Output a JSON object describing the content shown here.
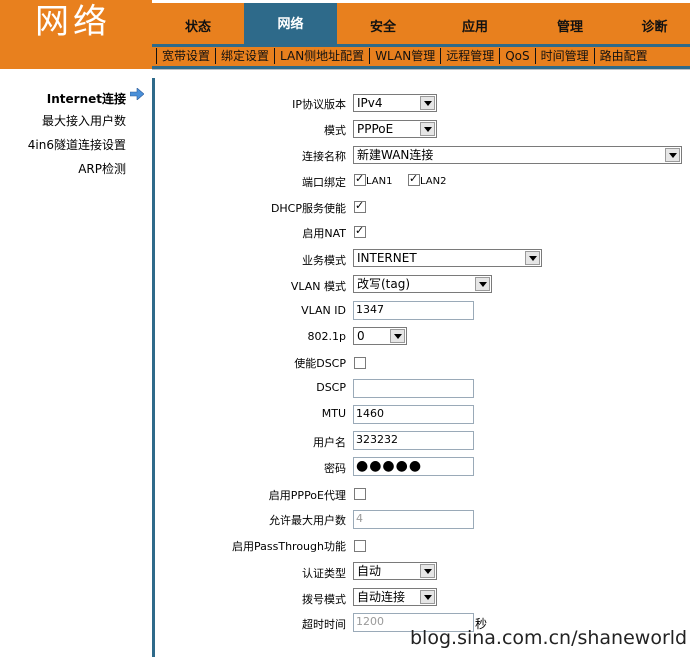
{
  "header": {
    "logo": "网络"
  },
  "topnav": [
    "状态",
    "网络",
    "安全",
    "应用",
    "管理",
    "诊断"
  ],
  "subnav": [
    "宽带设置",
    "绑定设置",
    "LAN侧地址配置",
    "WLAN管理",
    "远程管理",
    "QoS",
    "时间管理",
    "路由配置"
  ],
  "sidebar": [
    "Internet连接",
    "最大接入用户数",
    "4in6隧道连接设置",
    "ARP检测"
  ],
  "form": {
    "ip_version": {
      "label": "IP协议版本",
      "value": "IPv4"
    },
    "mode": {
      "label": "模式",
      "value": "PPPoE"
    },
    "conn_name": {
      "label": "连接名称",
      "value": "新建WAN连接"
    },
    "port_bind": {
      "label": "端口绑定",
      "lan1": "LAN1",
      "lan2": "LAN2"
    },
    "dhcp": {
      "label": "DHCP服务使能"
    },
    "nat": {
      "label": "启用NAT"
    },
    "service_mode": {
      "label": "业务模式",
      "value": "INTERNET"
    },
    "vlan_mode": {
      "label": "VLAN 模式",
      "value": "改写(tag)"
    },
    "vlan_id": {
      "label": "VLAN ID",
      "value": "1347"
    },
    "p8021": {
      "label": "802.1p",
      "value": "0"
    },
    "dscp_enable": {
      "label": "使能DSCP"
    },
    "dscp": {
      "label": "DSCP",
      "value": ""
    },
    "mtu": {
      "label": "MTU",
      "value": "1460"
    },
    "username": {
      "label": "用户名",
      "value": "323232"
    },
    "password": {
      "label": "密码",
      "value": "●●●●●"
    },
    "pppoe_proxy": {
      "label": "启用PPPoE代理"
    },
    "max_users": {
      "label": "允许最大用户数",
      "value": "4"
    },
    "passthrough": {
      "label": "启用PassThrough功能"
    },
    "auth_type": {
      "label": "认证类型",
      "value": "自动"
    },
    "dial_mode": {
      "label": "拨号模式",
      "value": "自动连接"
    },
    "timeout": {
      "label": "超时时间",
      "value": "1200",
      "unit": "秒"
    }
  },
  "watermark": "blog.sina.com.cn/shaneworld"
}
